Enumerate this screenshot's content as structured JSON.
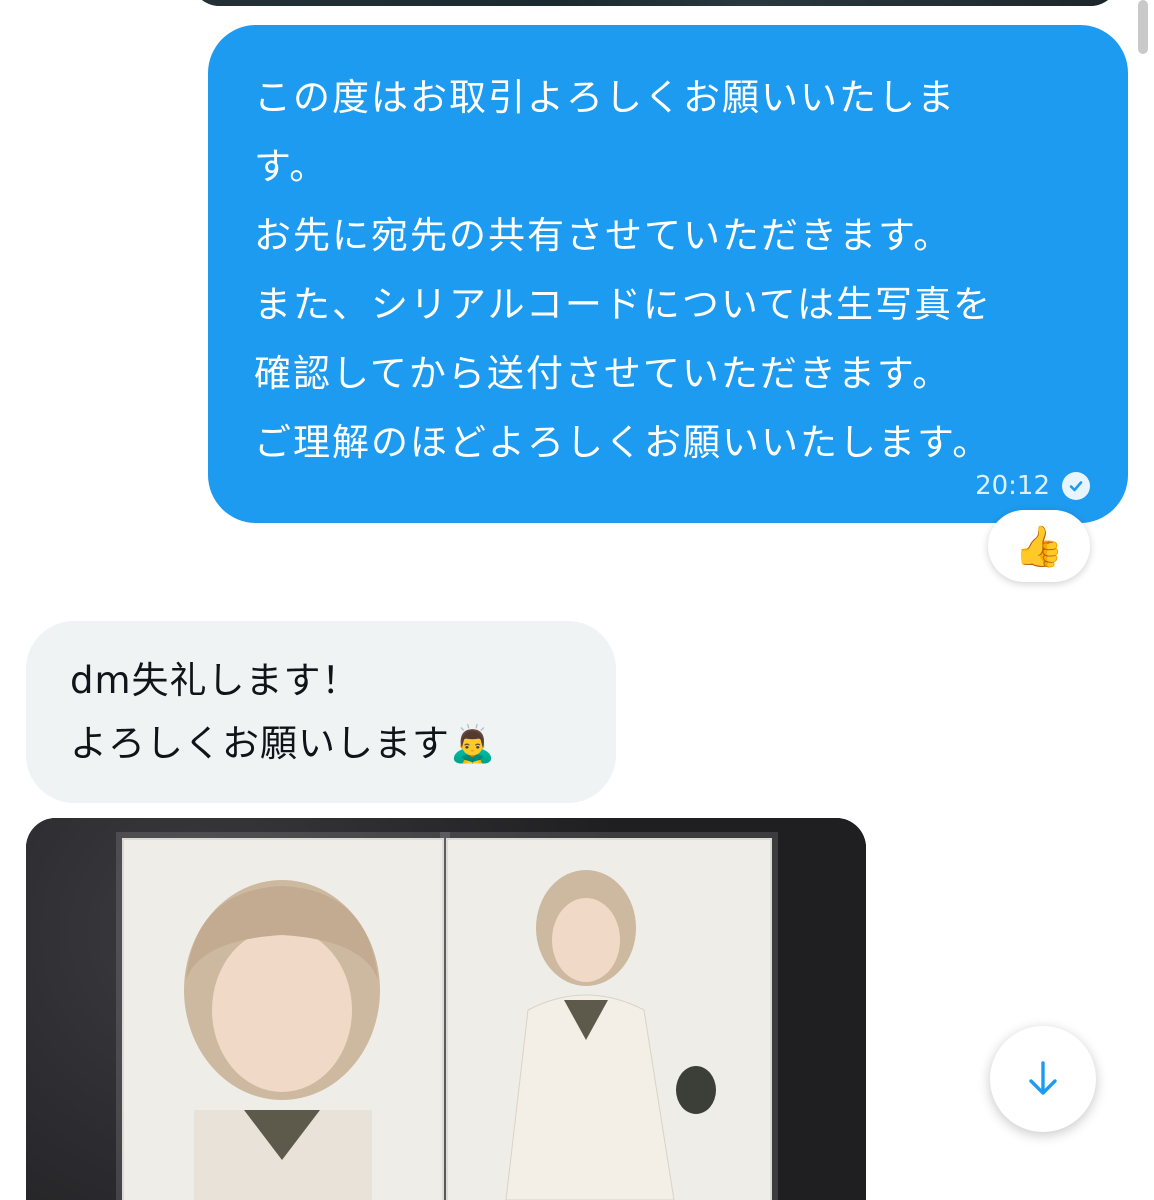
{
  "messages": {
    "outgoing": {
      "text": "この度はお取引よろしくお願いいたしま\nす。\nお先に宛先の共有させていただきます。\nまた、シリアルコードについては生写真を\n確認してから送付させていただきます。\nご理解のほどよろしくお願いいたします。",
      "time": "20:12",
      "status_icon": "check-circle-icon",
      "reaction": "👍"
    },
    "incoming": {
      "text": "dm失礼します！\nよろしくお願いします",
      "emoji": "🙇‍♂️"
    },
    "photo": {
      "description_icon": "photo-attachment"
    }
  },
  "controls": {
    "scroll_down_icon": "arrow-down-icon"
  },
  "colors": {
    "outgoing_bubble": "#1d9bf0",
    "incoming_bubble": "#eff3f4",
    "accent": "#1d9bf0"
  }
}
